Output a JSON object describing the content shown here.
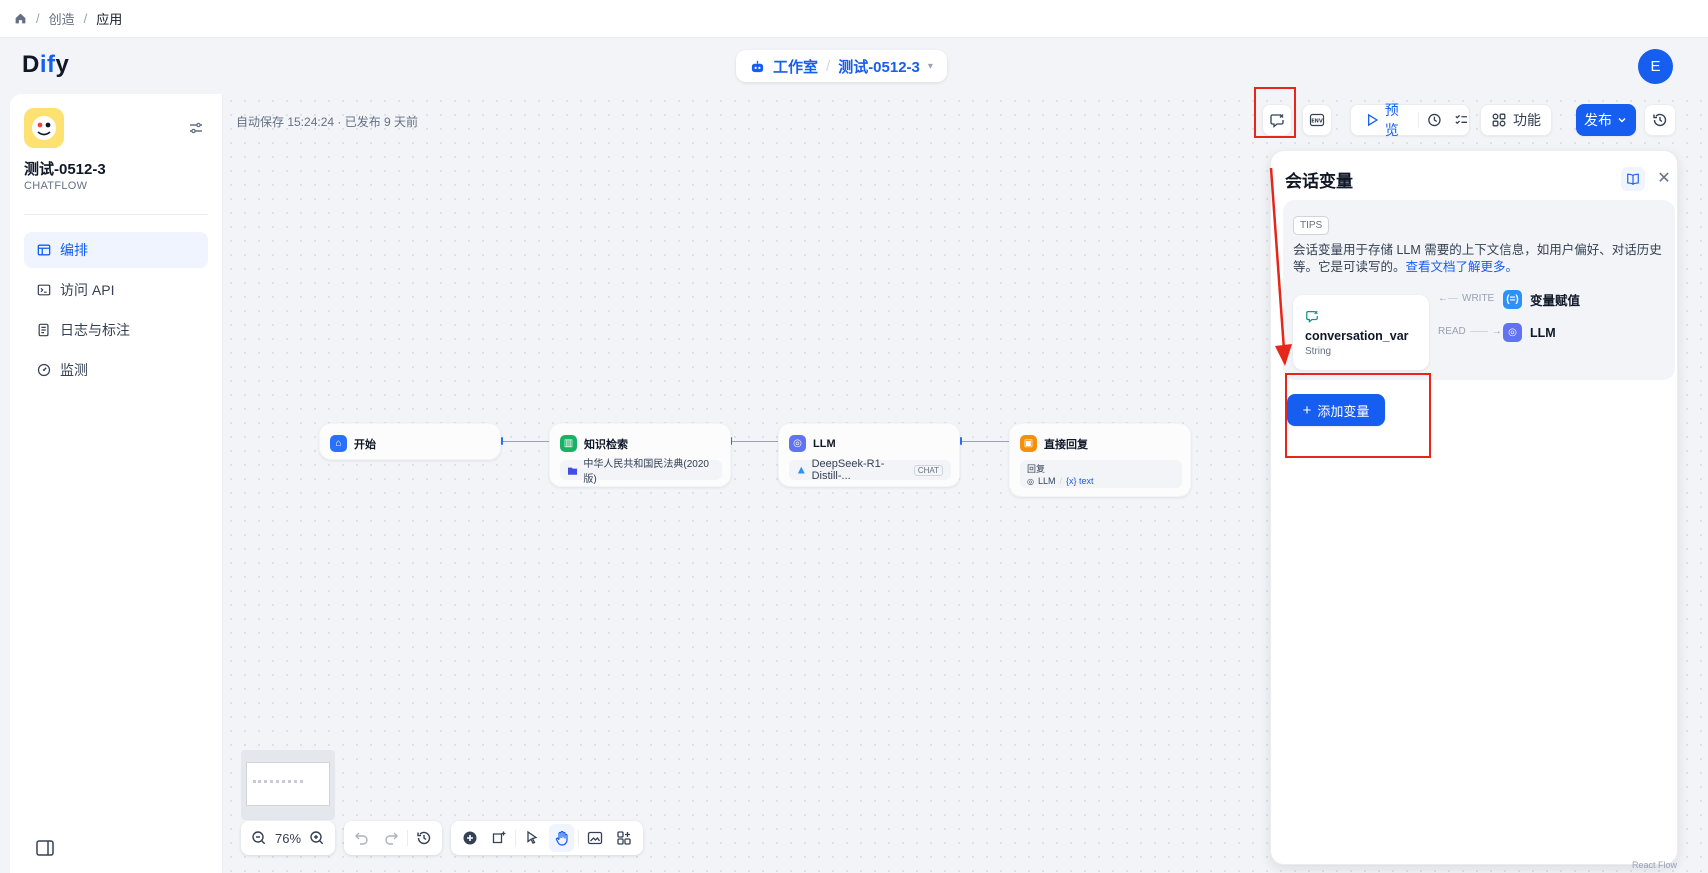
{
  "breadcrumb": {
    "items": [
      "创造",
      "应用"
    ]
  },
  "header": {
    "logo_prefix": "D",
    "logo_mid": "if",
    "logo_suffix": "y",
    "workspace": "工作室",
    "app": "测试-0512-3",
    "avatar": "E"
  },
  "sidebar": {
    "app_name": "测试-0512-3",
    "app_type": "CHATFLOW",
    "nav": [
      {
        "label": "编排",
        "active": true,
        "icon": "layout-icon"
      },
      {
        "label": "访问 API",
        "active": false,
        "icon": "terminal-icon"
      },
      {
        "label": "日志与标注",
        "active": false,
        "icon": "file-list-icon"
      },
      {
        "label": "监测",
        "active": false,
        "icon": "gauge-icon"
      }
    ]
  },
  "canvas": {
    "autosave": "自动保存 15:24:24 · 已发布 9 天前",
    "nodes": {
      "start": {
        "title": "开始",
        "color": "#2970ff"
      },
      "retrieval": {
        "title": "知识检索",
        "dataset": "中华人民共和国民法典(2020版)",
        "color": "#16b364"
      },
      "llm": {
        "title": "LLM",
        "model": "DeepSeek-R1-Distill-...",
        "tag": "CHAT",
        "color": "#6172f3"
      },
      "answer": {
        "title": "直接回复",
        "label": "回复",
        "ref_node": "LLM",
        "ref_var": "{x} text",
        "color": "#f79009"
      }
    },
    "zoom": "76%"
  },
  "toolbar": {
    "preview": "预览",
    "features": "功能",
    "publish": "发布"
  },
  "panel": {
    "title": "会话变量",
    "tips_tag": "TIPS",
    "tips_text": "会话变量用于存储 LLM 需要的上下文信息，如用户偏好、对话历史等。它是可读写的。",
    "tips_link": "查看文档了解更多。",
    "var_name": "conversation_var",
    "var_type": "String",
    "write_label": "WRITE",
    "read_label": "READ",
    "write_node": "变量赋值",
    "read_node": "LLM",
    "add_button": "添加变量"
  },
  "footer": {
    "attribution": "React Flow"
  },
  "colors": {
    "accent": "#155eef",
    "annotation": "#e8251a"
  }
}
